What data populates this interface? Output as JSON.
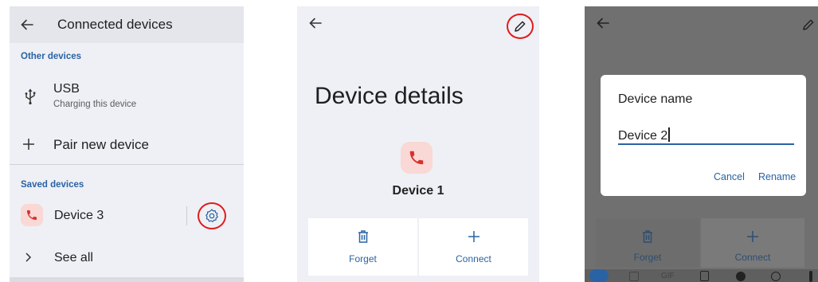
{
  "panel1": {
    "title": "Connected devices",
    "other_devices_label": "Other devices",
    "usb_title": "USB",
    "usb_subtitle": "Charging this device",
    "pair_label": "Pair new device",
    "saved_devices_label": "Saved devices",
    "saved_device_name": "Device 3",
    "see_all_label": "See all",
    "icons": [
      "back-arrow-icon",
      "usb-icon",
      "plus-icon",
      "phone-icon",
      "gear-icon",
      "chevron-right-icon"
    ]
  },
  "panel2": {
    "heading": "Device details",
    "device_name": "Device 1",
    "forget_label": "Forget",
    "connect_label": "Connect",
    "icons": [
      "back-arrow-icon",
      "pencil-icon",
      "phone-icon",
      "trash-icon",
      "plus-icon"
    ]
  },
  "panel3": {
    "dialog_title": "Device name",
    "input_value": "Device 2",
    "cancel_label": "Cancel",
    "rename_label": "Rename",
    "forget_label": "Forget",
    "connect_label": "Connect",
    "keyboard_gif_label": "GIF"
  },
  "colors": {
    "accent": "#2a63a3",
    "highlight_circle": "#e01b1b",
    "device_icon_bg": "#f9d8d6",
    "device_icon_fg": "#d9302c"
  }
}
